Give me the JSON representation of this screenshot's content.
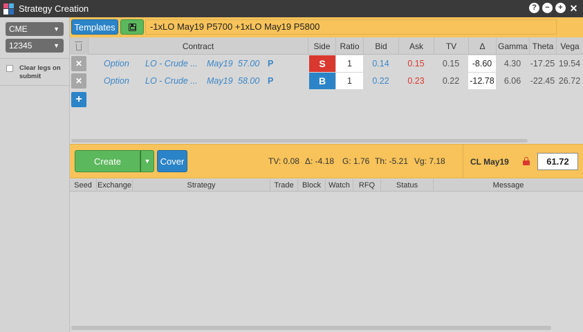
{
  "window": {
    "title": "Strategy Creation"
  },
  "left_panel": {
    "exchange_select": "CME",
    "account_select": "12345",
    "clear_legs_label": "Clear legs on submit"
  },
  "toolbar": {
    "templates_label": "Templates",
    "strategy_text": "-1xLO May19 P5700 +1xLO May19 P5800"
  },
  "legs_table": {
    "headers": {
      "contract": "Contract",
      "side": "Side",
      "ratio": "Ratio",
      "bid": "Bid",
      "ask": "Ask",
      "tv": "TV",
      "delta": "Δ",
      "gamma": "Gamma",
      "theta": "Theta",
      "vega": "Vega"
    },
    "rows": [
      {
        "type": "Option",
        "product": "LO - Crude ...",
        "expiry": "May19",
        "strike": "57.00",
        "cp": "P",
        "side": "S",
        "ratio": "1",
        "bid": "0.14",
        "ask": "0.15",
        "tv": "0.15",
        "delta": "-8.60",
        "gamma": "4.30",
        "theta": "-17.25",
        "vega": "19.54"
      },
      {
        "type": "Option",
        "product": "LO - Crude ...",
        "expiry": "May19",
        "strike": "58.00",
        "cp": "P",
        "side": "B",
        "ratio": "1",
        "bid": "0.22",
        "ask": "0.23",
        "tv": "0.22",
        "delta": "-12.78",
        "gamma": "6.06",
        "theta": "-22.45",
        "vega": "26.72"
      }
    ]
  },
  "create_bar": {
    "create_label": "Create",
    "cover_label": "Cover",
    "tv": "TV: 0.08",
    "delta": "Δ: -4.18",
    "gamma": "G: 1.76",
    "theta": "Th: -5.21",
    "vega": "Vg: 7.18",
    "underlying": "CL May19",
    "underlying_price": "61.72"
  },
  "results_table": {
    "headers": {
      "seed": "Seed",
      "exchange": "Exchange",
      "strategy": "Strategy",
      "trade": "Trade",
      "block": "Block",
      "watch": "Watch",
      "rfq": "RFQ",
      "status": "Status",
      "message": "Message"
    }
  },
  "colors": {
    "accent_orange": "#f7c35a",
    "blue": "#2b84c7",
    "green": "#5cb85c",
    "red": "#d9382f"
  }
}
